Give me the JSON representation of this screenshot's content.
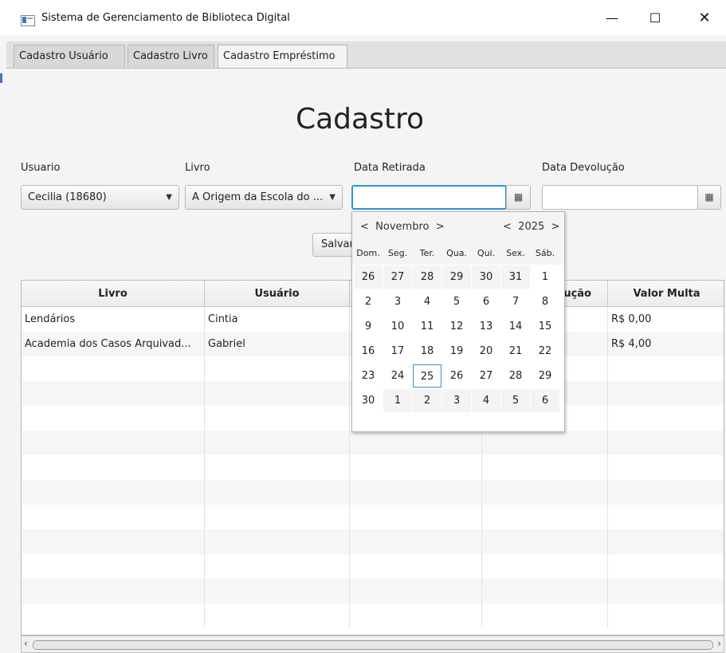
{
  "window": {
    "title": "Sistema de Gerenciamento de Biblioteca Digital",
    "minimize": "—",
    "maximize": "☐",
    "close": "✕"
  },
  "tabs": [
    {
      "label": "Cadastro Usuário"
    },
    {
      "label": "Cadastro Livro"
    },
    {
      "label": "Cadastro Empréstimo"
    }
  ],
  "form": {
    "heading": "Cadastro",
    "usuario_label": "Usuario",
    "usuario_value": "Cecilia (18680)",
    "livro_label": "Livro",
    "livro_value": "A Origem da Escola do ...",
    "data_retirada_label": "Data Retirada",
    "data_devolucao_label": "Data Devolução",
    "save_label": "Salvar"
  },
  "icons": {
    "calendar": "calendar-icon",
    "dropdown": "chevron-down-icon"
  },
  "table": {
    "headers": [
      "Livro",
      "Usuário",
      "",
      "ução",
      "Valor Multa"
    ],
    "rows": [
      [
        "Lendários",
        "Cintia",
        "",
        "",
        "R$ 0,00"
      ],
      [
        "Academia dos Casos Arquivad...",
        "Gabriel",
        "",
        "",
        "R$ 4,00"
      ]
    ]
  },
  "datepicker": {
    "month": "Novembro",
    "year": "2025",
    "prev": "<",
    "next": ">",
    "weekdays": [
      "Dom.",
      "Seg.",
      "Ter.",
      "Qua.",
      "Qui.",
      "Sex.",
      "Sáb."
    ],
    "weeks": [
      [
        "26",
        "27",
        "28",
        "29",
        "30",
        "31",
        "1"
      ],
      [
        "2",
        "3",
        "4",
        "5",
        "6",
        "7",
        "8"
      ],
      [
        "9",
        "10",
        "11",
        "12",
        "13",
        "14",
        "15"
      ],
      [
        "16",
        "17",
        "18",
        "19",
        "20",
        "21",
        "22"
      ],
      [
        "23",
        "24",
        "25",
        "26",
        "27",
        "28",
        "29"
      ],
      [
        "30",
        "1",
        "2",
        "3",
        "4",
        "5",
        "6"
      ]
    ],
    "today": "25"
  },
  "colors": {
    "focus": "#2d93d5",
    "accent": "#3a78c3"
  }
}
